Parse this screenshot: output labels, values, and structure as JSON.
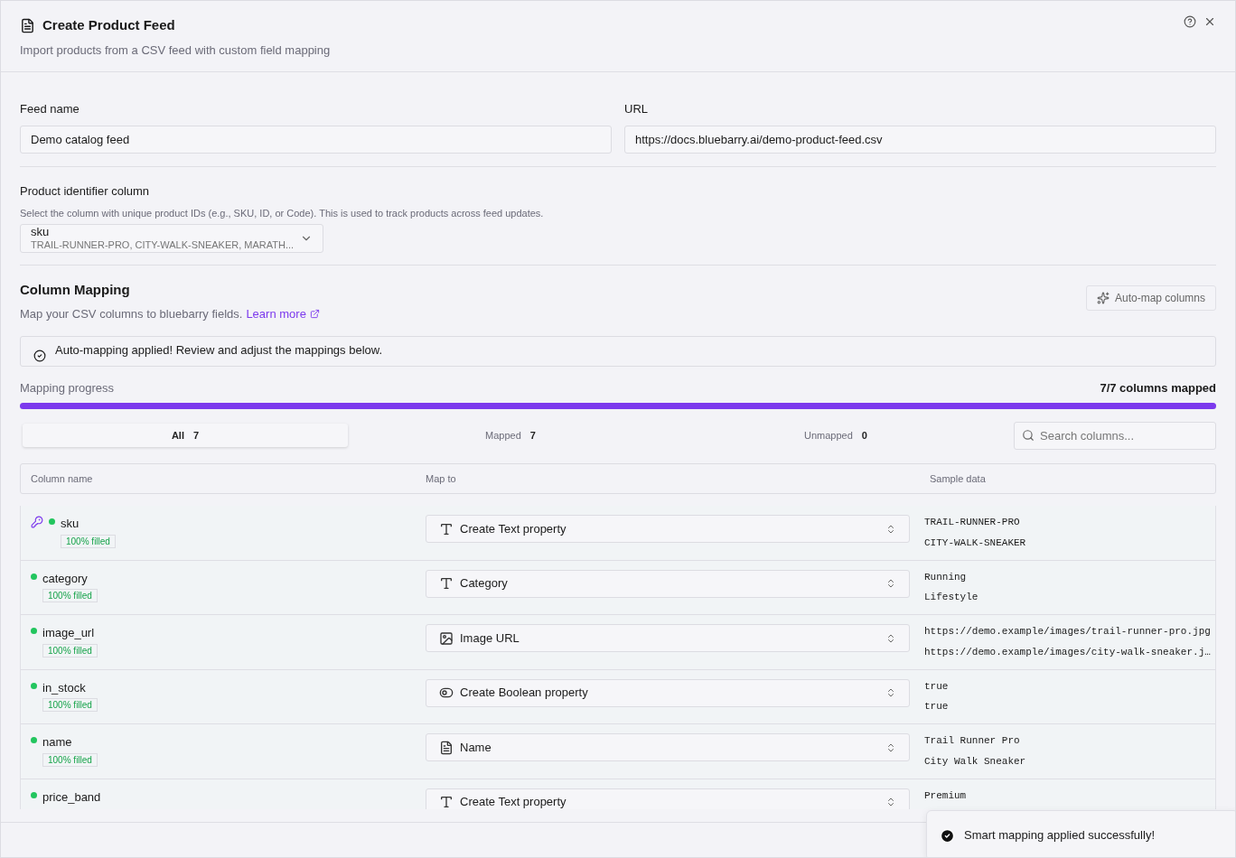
{
  "dialog": {
    "title": "Create Product Feed",
    "subtitle": "Import products from a CSV feed with custom field mapping"
  },
  "fields": [
    {
      "label": "Feed name",
      "value": "Demo catalog feed"
    },
    {
      "label": "URL",
      "value": "https://docs.bluebarry.ai/demo-product-feed.csv"
    }
  ],
  "identifier": {
    "label": "Product identifier column",
    "hint": "Select the column with unique product IDs (e.g., SKU, ID, or Code). This is used to track products across feed updates.",
    "value": "sku",
    "preview": "TRAIL-RUNNER-PRO, CITY-WALK-SNEAKER, MARATH..."
  },
  "mapping": {
    "title": "Column Mapping",
    "description": "Map your CSV columns to bluebarry fields.",
    "link": "Learn more",
    "auto_button": "Auto-map columns",
    "alert": "Auto-mapping applied! Review and adjust the mappings below.",
    "progress_label": "Mapping progress",
    "progress_text": "7/7 columns mapped",
    "level": 1
  },
  "tabs": [
    {
      "label": "All",
      "count": "7",
      "selected": true
    },
    {
      "label": "Mapped",
      "count": "7",
      "selected": false
    },
    {
      "label": "Unmapped",
      "count": "0",
      "selected": false
    }
  ],
  "search": {
    "placeholder": "Search columns..."
  },
  "table": {
    "columns": [
      "Column name",
      "Map to",
      "Sample data"
    ],
    "rows": [
      {
        "name": "sku",
        "identifier": true,
        "color": "#22c55e",
        "filled": "100% filled",
        "kind": "text",
        "map_to": "Create Text property",
        "samples": [
          "TRAIL-RUNNER-PRO",
          "CITY-WALK-SNEAKER"
        ]
      },
      {
        "name": "category",
        "identifier": false,
        "color": "#22c55e",
        "filled": "100% filled",
        "kind": "text",
        "map_to": "Category",
        "samples": [
          "Running",
          "Lifestyle"
        ]
      },
      {
        "name": "image_url",
        "identifier": false,
        "color": "#22c55e",
        "filled": "100% filled",
        "kind": "image",
        "map_to": "Image URL",
        "samples": [
          "https://demo.example/images/trail-runner-pro.jpg",
          "https://demo.example/images/city-walk-sneaker.j…"
        ]
      },
      {
        "name": "in_stock",
        "identifier": false,
        "color": "#22c55e",
        "filled": "100% filled",
        "kind": "boolean",
        "map_to": "Create Boolean property",
        "samples": [
          "true",
          "true"
        ]
      },
      {
        "name": "name",
        "identifier": false,
        "color": "#22c55e",
        "filled": "100% filled",
        "kind": "document",
        "map_to": "Name",
        "samples": [
          "Trail Runner Pro",
          "City Walk Sneaker"
        ]
      },
      {
        "name": "price_band",
        "identifier": false,
        "color": "#22c55e",
        "kind": "text",
        "map_to": "Create Text property",
        "samples": [
          "Premium"
        ]
      }
    ]
  },
  "toast": {
    "message": "Smart mapping applied successfully!"
  }
}
